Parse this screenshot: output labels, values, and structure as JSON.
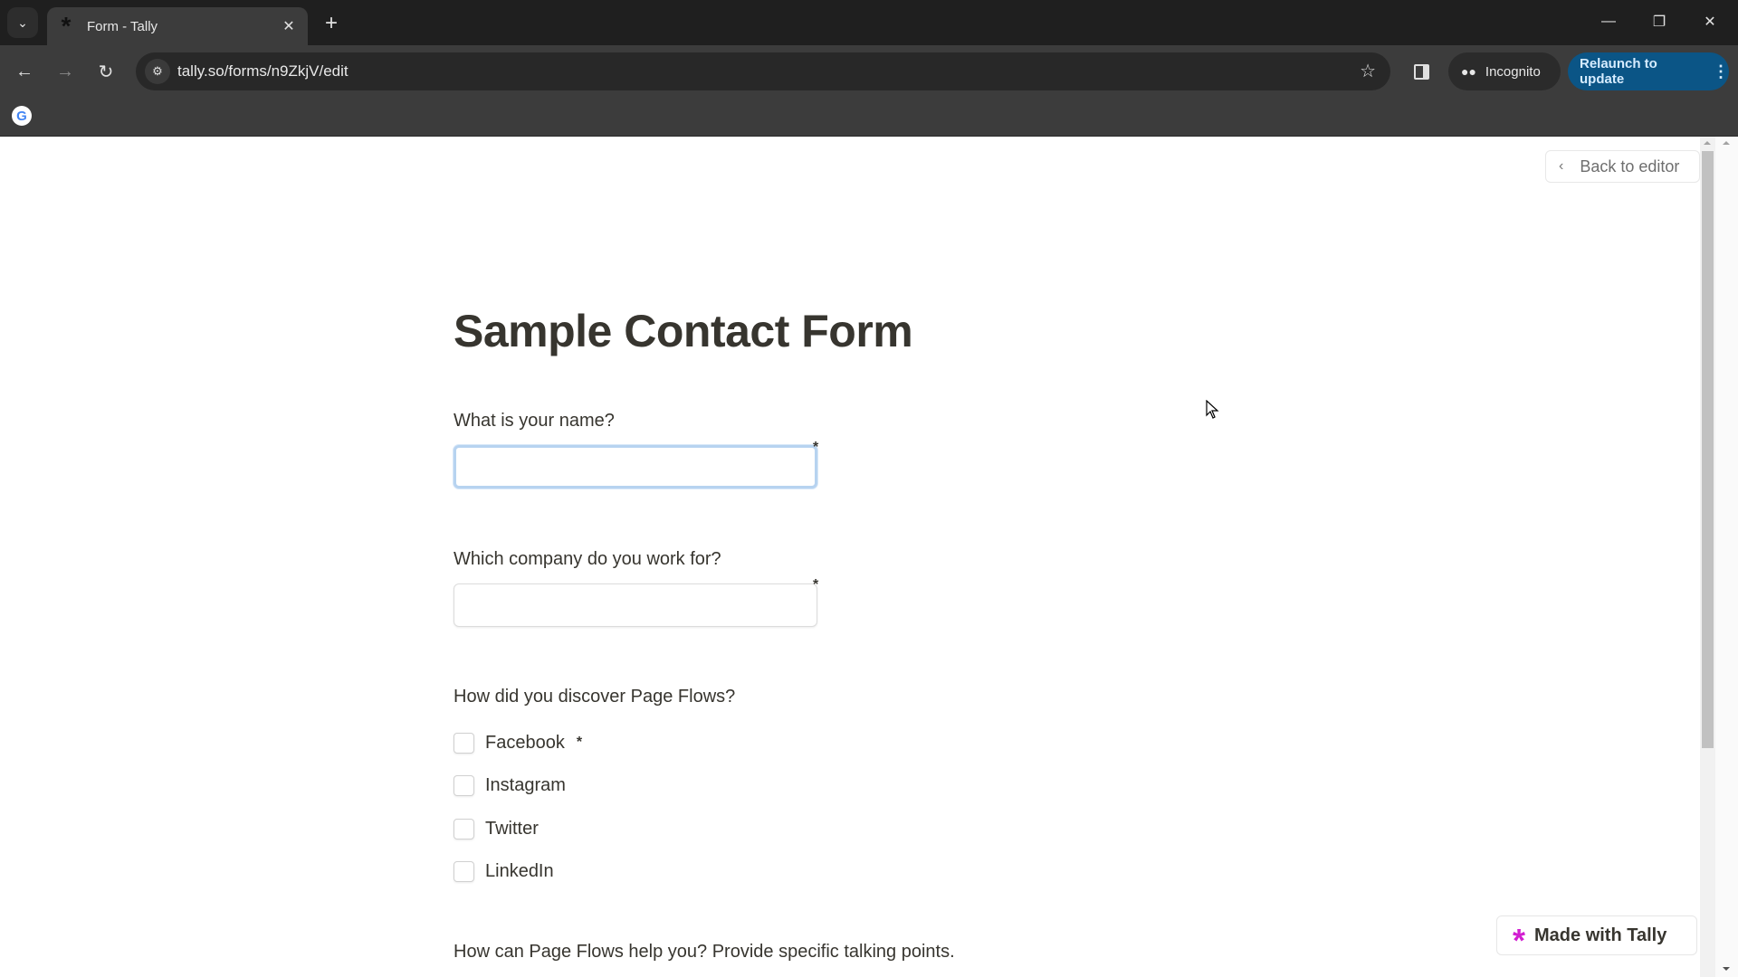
{
  "browser": {
    "tab": {
      "title": "Form - Tally",
      "favicon": "tally-asterisk-icon"
    },
    "url": "tally.so/forms/n9ZkjV/edit",
    "incognito_label": "Incognito",
    "relaunch_label": "Relaunch to update",
    "icons": {
      "tab_search": "⌄",
      "close": "✕",
      "new_tab": "+",
      "back": "←",
      "forward": "→",
      "reload": "↻",
      "site_info": "⚙",
      "star": "☆",
      "minimize": "—",
      "maximize": "❐",
      "window_close": "✕",
      "menu": "⋮",
      "incognito": "🕶",
      "google": "G"
    }
  },
  "page": {
    "back_to_editor": {
      "icon": "‹",
      "label": "Back to editor"
    },
    "form": {
      "title": "Sample Contact Form",
      "questions": [
        {
          "label": "What is your name?",
          "type": "text",
          "value": "",
          "required": "*",
          "focused": true
        },
        {
          "label": "Which company do you work for?",
          "type": "text",
          "value": "",
          "required": "*"
        },
        {
          "label": "How did you discover Page Flows?",
          "type": "checkboxes",
          "required": "*",
          "options": [
            "Facebook",
            "Instagram",
            "Twitter",
            "LinkedIn"
          ]
        },
        {
          "label": "How can Page Flows help you? Provide specific talking points.",
          "type": "textarea"
        }
      ]
    },
    "made_with": {
      "icon": "*",
      "label": "Made with Tally",
      "accent": "#d21fd1"
    }
  }
}
